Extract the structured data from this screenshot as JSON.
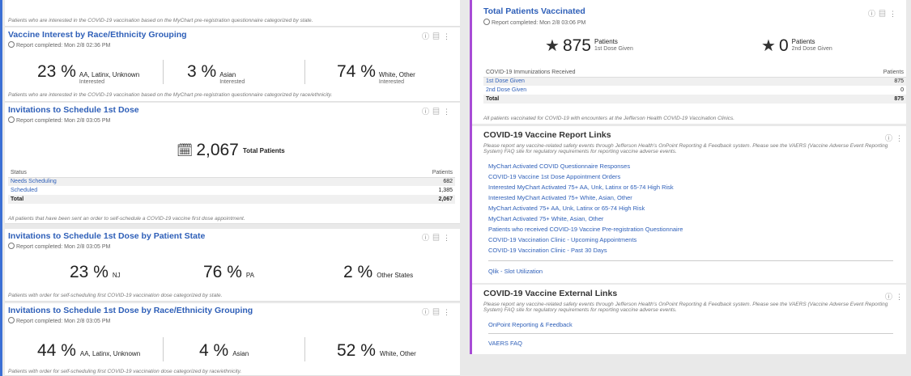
{
  "left": {
    "top_fragment": {
      "note": "Patients who are interested in the COVID-19 vaccination based on the MyChart pre-registration questionnaire categorized by state."
    },
    "race_interest": {
      "title": "Vaccine Interest by Race/Ethnicity Grouping",
      "time": "Report completed: Mon 2/8 02:36 PM",
      "metrics": [
        {
          "num": "23 %",
          "a": "AA, Latinx, Unknown",
          "b": "Interested"
        },
        {
          "num": "3 %",
          "a": "Asian",
          "b": "Interested"
        },
        {
          "num": "74 %",
          "a": "White, Other",
          "b": "Interested"
        }
      ],
      "note": "Patients who are interested in the COVID-19 vaccination based on the MyChart pre-registration questionnaire categorized by race/ethnicity."
    },
    "invitations": {
      "title": "Invitations to Schedule 1st Dose",
      "time": "Report completed: Mon 2/8 03:05 PM",
      "total_num": "2,067",
      "total_label": "Total Patients",
      "table": {
        "headers": [
          "Status",
          "Patients"
        ],
        "rows": [
          {
            "label": "Needs Scheduling",
            "value": "682"
          },
          {
            "label": "Scheduled",
            "value": "1,385"
          },
          {
            "label": "Total",
            "value": "2,067"
          }
        ]
      },
      "note": "All patients that have been sent an order to self-schedule a COVID-19 vaccine first dose appointment."
    },
    "by_state": {
      "title": "Invitations to Schedule 1st Dose by Patient State",
      "time": "Report completed: Mon 2/8 03:05 PM",
      "metrics": [
        {
          "num": "23 %",
          "a": "NJ"
        },
        {
          "num": "76 %",
          "a": "PA"
        },
        {
          "num": "2 %",
          "a": "Other States"
        }
      ],
      "note": "Patients with order for self-scheduling first COVID-19 vaccination dose categorized by state."
    },
    "by_race": {
      "title": "Invitations to Schedule 1st Dose by Race/Ethnicity Grouping",
      "time": "Report completed: Mon 2/8 03:05 PM",
      "metrics": [
        {
          "num": "44 %",
          "a": "AA, Latinx, Unknown"
        },
        {
          "num": "4 %",
          "a": "Asian"
        },
        {
          "num": "52 %",
          "a": "White, Other"
        }
      ],
      "note": "Patients with order for self-scheduling first COVID-19 vaccination dose categorized by race/ethnicity."
    }
  },
  "right": {
    "vaccinated": {
      "title": "Total Patients Vaccinated",
      "time": "Report completed: Mon 2/8 03:06 PM",
      "first": {
        "num": "875",
        "a": "Patients",
        "b": "1st Dose Given"
      },
      "second": {
        "num": "0",
        "a": "Patients",
        "b": "2nd Dose Given"
      },
      "table": {
        "headers": [
          "COVID-19 Immunizations Received",
          "Patients"
        ],
        "rows": [
          {
            "label": "1st Dose Given",
            "value": "875"
          },
          {
            "label": "2nd Dose Given",
            "value": "0"
          },
          {
            "label": "Total",
            "value": "875"
          }
        ]
      },
      "note": "All patients vaccinated for COVID-19 with encounters at the Jefferson Health COVID-19 Vaccination Clinics."
    },
    "report_links": {
      "title": "COVID-19 Vaccine Report Links",
      "desc": "Please report any vaccine-related safety events through Jefferson Health's OnPoint Reporting & Feedback system. Please see the VAERS (Vaccine Adverse Event Reporting System) FAQ site for regulatory requirements for reporting vaccine adverse events.",
      "links": [
        "MyChart Activated COVID Questionnaire Responses",
        "COVID-19 Vaccine 1st Dose Appointment Orders",
        "Interested MyChart Activated 75+ AA, Unk, Latinx or 65-74 High Risk",
        "Interested MyChart Activated 75+ White, Asian, Other",
        "MyChart Activated 75+ AA, Unk, Latinx or 65-74 High Risk",
        "MyChart Activated 75+ White, Asian, Other",
        "Patients who received COVID-19 Vaccine Pre-registration Questionnaire",
        "COVID-19 Vaccination Clinic - Upcoming Appointments",
        "COVID-19 Vaccination Clinic - Past 30 Days"
      ],
      "extra_link": "Qlik - Slot Utilization"
    },
    "external_links": {
      "title": "COVID-19 Vaccine External Links",
      "desc": "Please report any vaccine-related safety events through Jefferson Health's OnPoint Reporting & Feedback system. Please see the VAERS (Vaccine Adverse Event Reporting System) FAQ site for regulatory requirements for reporting vaccine adverse events.",
      "links": [
        "OnPoint Reporting & Feedback",
        "VAERS FAQ"
      ]
    }
  },
  "icons": {
    "info": "info-icon",
    "report": "report-icon",
    "more": "more-vertical-icon",
    "clock": "clock-icon",
    "star": "star-icon",
    "calendar": "calendar-icon"
  }
}
